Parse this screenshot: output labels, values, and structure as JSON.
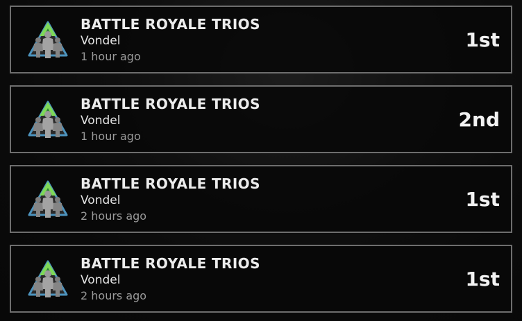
{
  "matches": [
    {
      "mode": "BATTLE ROYALE TRIOS",
      "map": "Vondel",
      "time": "1 hour ago",
      "placement": "1st",
      "icon": "trios-team-icon"
    },
    {
      "mode": "BATTLE ROYALE TRIOS",
      "map": "Vondel",
      "time": "1 hour ago",
      "placement": "2nd",
      "icon": "trios-team-icon"
    },
    {
      "mode": "BATTLE ROYALE TRIOS",
      "map": "Vondel",
      "time": "2 hours ago",
      "placement": "1st",
      "icon": "trios-team-icon"
    },
    {
      "mode": "BATTLE ROYALE TRIOS",
      "map": "Vondel",
      "time": "2 hours ago",
      "placement": "1st",
      "icon": "trios-team-icon"
    }
  ],
  "colors": {
    "accent_green": "#7ed957",
    "card_border": "#6e6e6e",
    "emblem_blue": "#4d93bd"
  }
}
